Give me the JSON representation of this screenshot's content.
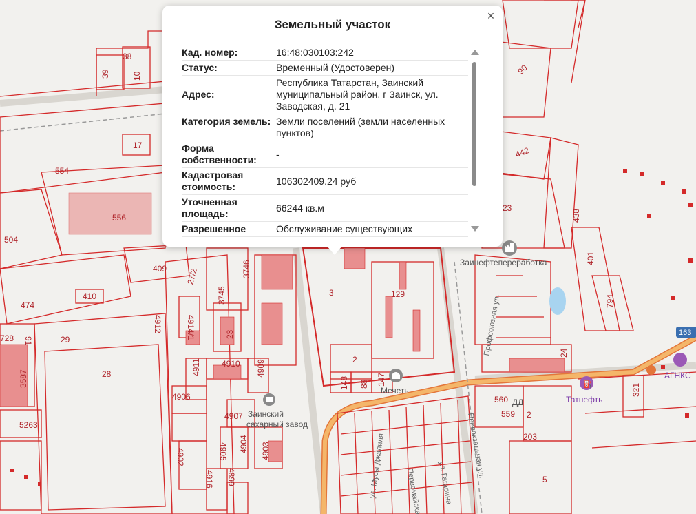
{
  "popup": {
    "title": "Земельный участок",
    "close_label": "×",
    "rows": [
      {
        "key": "Кад. номер:",
        "value": "16:48:030103:242"
      },
      {
        "key": "Статус:",
        "value": "Временный (Удостоверен)"
      },
      {
        "key": "Адрес:",
        "value": "Республика Татарстан, Заинский муниципальный район, г Заинск, ул. Заводская, д. 21"
      },
      {
        "key": "Категория земель:",
        "value": "Земли поселений (земли населенных пунктов)"
      },
      {
        "key": "Форма собственности:",
        "value": "-"
      },
      {
        "key": "Кадастровая стоимость:",
        "value": "106302409.24 руб"
      },
      {
        "key": "Уточненная площадь:",
        "value": "66244 кв.м"
      },
      {
        "key": "Разрешенное",
        "value": "Обслуживание существующих"
      }
    ]
  },
  "map": {
    "parcel_labels": [
      "39",
      "38",
      "10",
      "17",
      "554",
      "556",
      "504",
      "409",
      "410",
      "474",
      "3746",
      "3745",
      "27/2",
      "4914/1",
      "4912",
      "23",
      "728",
      "91",
      "29",
      "3587",
      "28",
      "4910",
      "4911",
      "4909",
      "4906",
      "4907",
      "4902",
      "4905",
      "4904",
      "4903",
      "4899",
      "4916",
      "5263",
      "3",
      "129",
      "2",
      "148",
      "88",
      "147",
      "90",
      "442",
      "23",
      "438",
      "401",
      "794",
      "24",
      "321",
      "560",
      "559",
      "2",
      "203",
      "5",
      "163"
    ],
    "pois": {
      "factory": "Заинефтепереработка",
      "mosque": "Мечеть",
      "sugar_factory_line1": "Заинский",
      "sugar_factory_line2": "сахарный завод",
      "gas_station": "Татнефть",
      "agnks": "АГНКС",
      "dd": "ДД",
      "gas_badge": "163"
    },
    "streets": {
      "profsoyuznaya": "Профсоюзная ул.",
      "privokzalnaya": "Привокзальная ул.",
      "musy_jalilya": "ул. Мусы Джалиля",
      "pervomayskaya": "Первомайская ул.",
      "gagarina": "ул. Гагарина"
    },
    "colors": {
      "parcel_line": "#d42a2a",
      "parcel_fill": "#e88f8f",
      "road_main": "#f4b66a",
      "background": "#f2f1ee"
    }
  }
}
